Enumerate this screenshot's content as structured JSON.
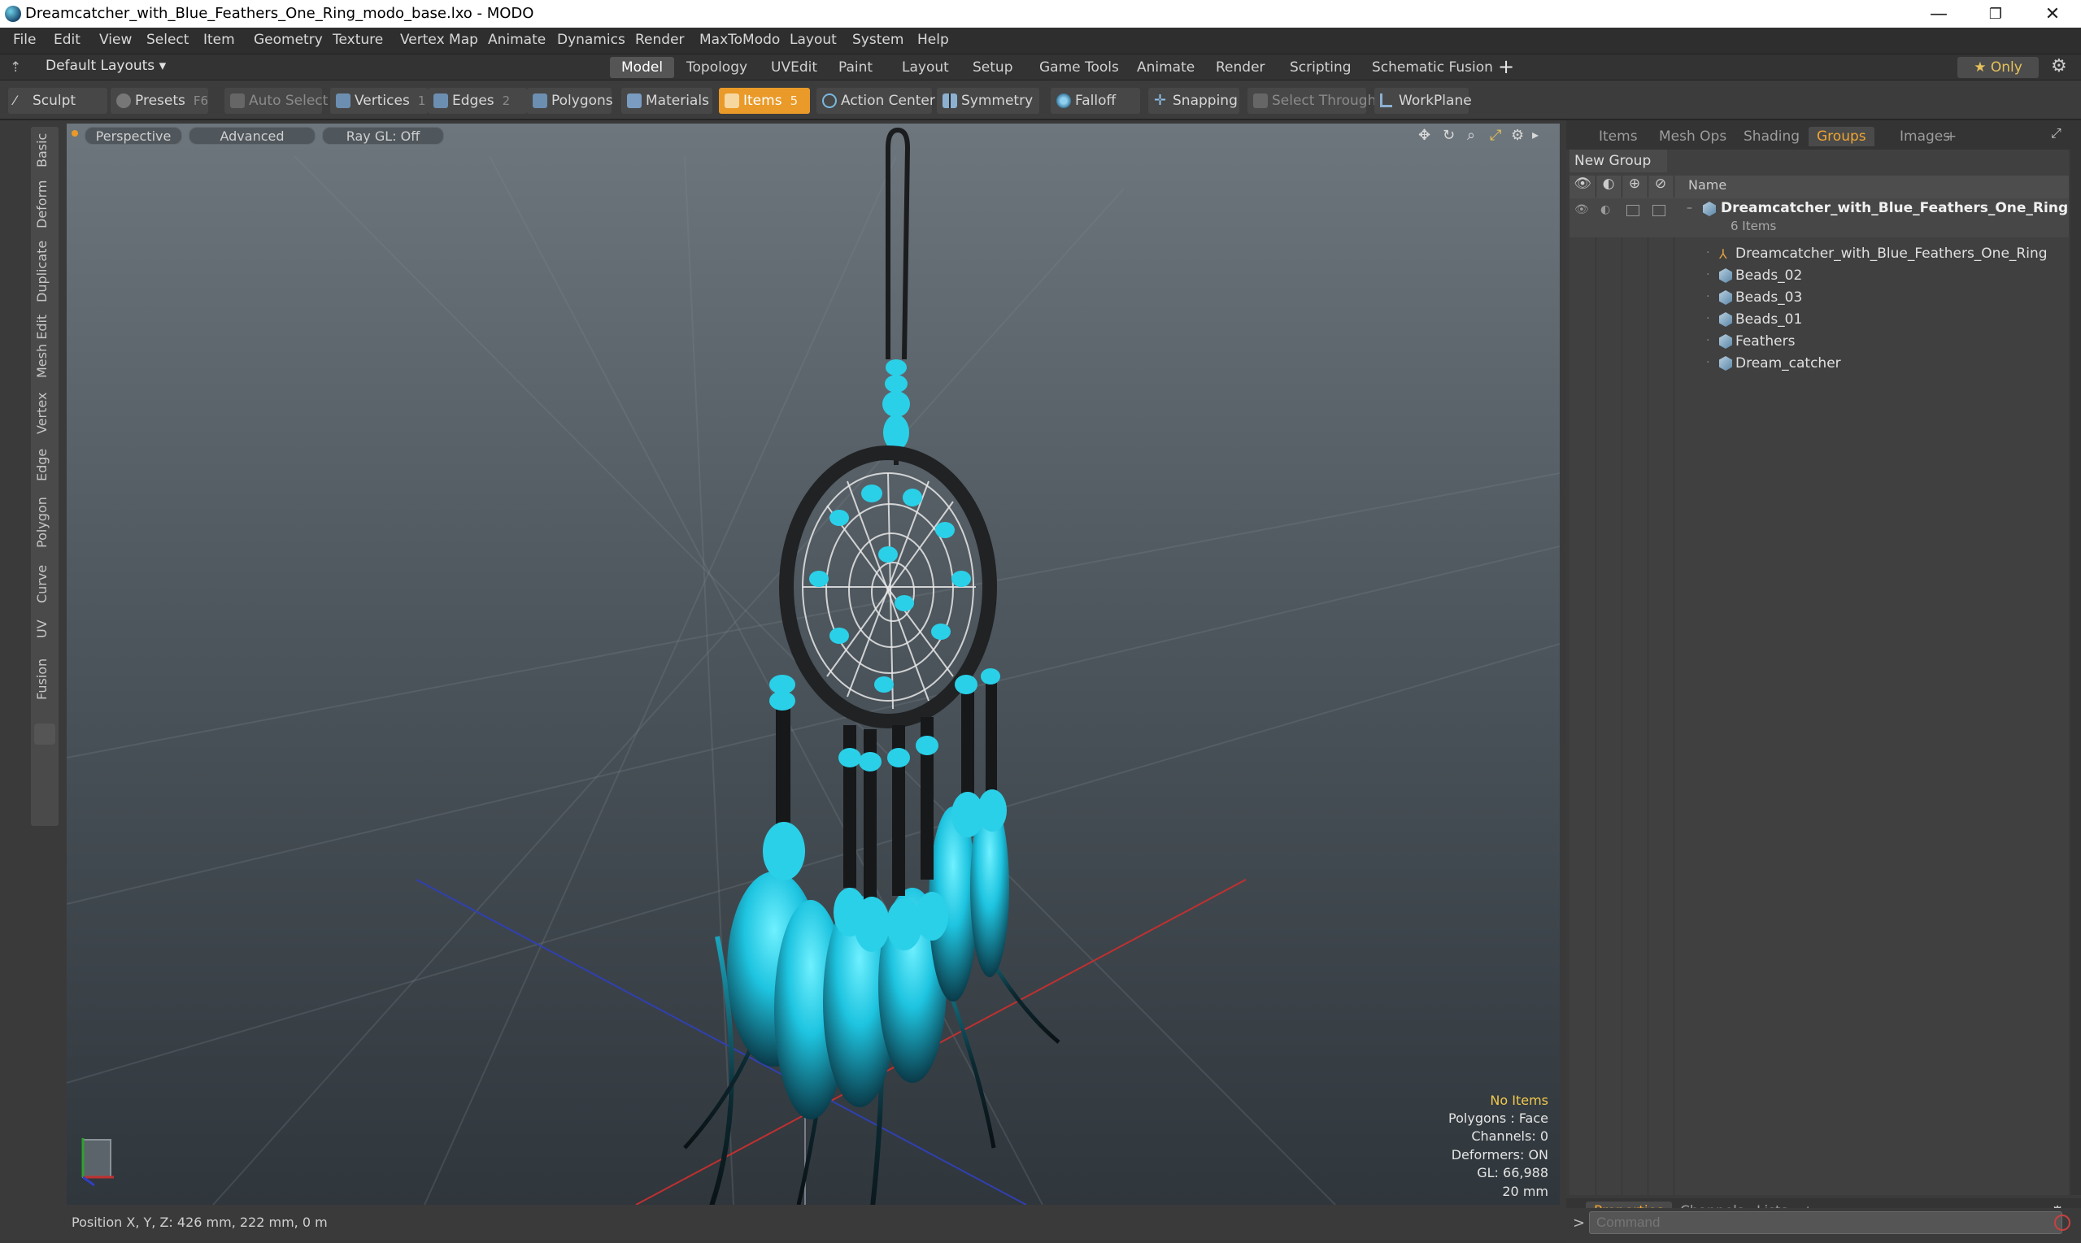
{
  "window": {
    "title": "Dreamcatcher_with_Blue_Feathers_One_Ring_modo_base.lxo - MODO",
    "minimize_glyph": "—",
    "maximize_glyph": "❐",
    "close_glyph": "✕"
  },
  "menus": [
    "File",
    "Edit",
    "View",
    "Select",
    "Item",
    "Geometry",
    "Texture",
    "Vertex Map",
    "Animate",
    "Dynamics",
    "Render",
    "MaxToModo",
    "Layout",
    "System",
    "Help"
  ],
  "layout_selector": "Default Layouts ▾",
  "mode_tabs": [
    "Model",
    "Topology",
    "UVEdit",
    "Paint",
    "Layout",
    "Setup",
    "Game Tools",
    "Animate",
    "Render",
    "Scripting",
    "Schematic Fusion"
  ],
  "mode_tab_add": "+",
  "only_button": "★  Only",
  "toolbar": {
    "sculpt": "Sculpt",
    "presets": "Presets",
    "presets_key": "F6",
    "auto_select": "Auto Select",
    "vertices": "Vertices",
    "vertices_key": "1",
    "edges": "Edges",
    "edges_key": "2",
    "polygons": "Polygons",
    "materials": "Materials",
    "items": "Items",
    "items_key": "5",
    "action_center": "Action Center",
    "symmetry": "Symmetry",
    "falloff": "Falloff",
    "snapping": "Snapping",
    "select_through": "Select Through",
    "workplane": "WorkPlane"
  },
  "left_tabs": [
    "Basic",
    "Deform",
    "Duplicate",
    "Mesh Edit",
    "Vertex",
    "Edge",
    "Polygon",
    "Curve",
    "UV",
    "Fusion"
  ],
  "viewport": {
    "perspective": "Perspective",
    "advanced": "Advanced",
    "raygl": "Ray GL: Off",
    "info": {
      "no_items": "No Items",
      "polygons": "Polygons : Face",
      "channels": "Channels: 0",
      "deformers": "Deformers: ON",
      "gl": "GL: 66,988",
      "scale": "20 mm"
    }
  },
  "status": {
    "position": "Position X, Y, Z:  426 mm, 222 mm, 0 m"
  },
  "right_panel": {
    "tabs": [
      "Items",
      "Mesh Ops",
      "Shading",
      "Groups",
      "Images"
    ],
    "active_tab": "Groups",
    "tab_add": "+",
    "new_group": "New Group",
    "column_name": "Name",
    "group_name": "Dreamcatcher_with_Blue_Feathers_One_Ring ...",
    "group_count": "6 Items",
    "children": [
      "Dreamcatcher_with_Blue_Feathers_One_Ring",
      "Beads_02",
      "Beads_03",
      "Beads_01",
      "Feathers",
      "Dream_catcher"
    ],
    "bottom_tabs": [
      "Properties",
      "Channels",
      "Lists"
    ],
    "bottom_active": "Properties",
    "command_placeholder": "Command",
    "command_prompt": ">"
  },
  "colors": {
    "accent": "#e99a29",
    "feather_blue": "#2ad0e8",
    "x_axis": "#c03030",
    "z_axis": "#3040b0"
  }
}
